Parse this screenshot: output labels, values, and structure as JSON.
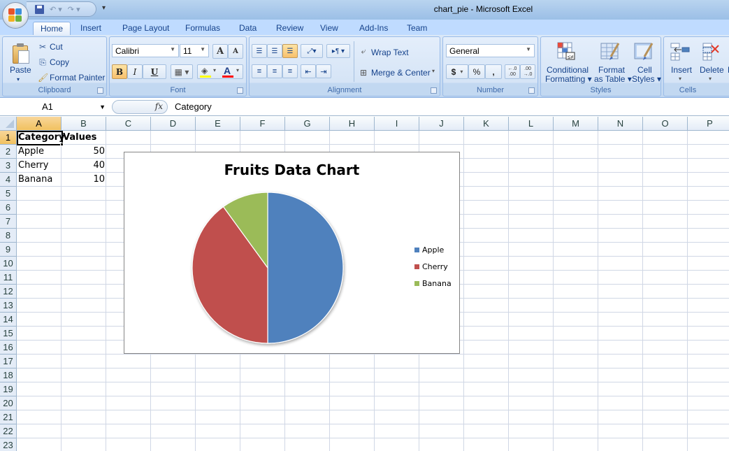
{
  "window": {
    "title": "chart_pie - Microsoft Excel"
  },
  "quick_access": {
    "items": [
      {
        "name": "save",
        "icon": "save-icon"
      },
      {
        "name": "undo",
        "icon": "undo-icon",
        "glyph": "↶ ▾"
      },
      {
        "name": "redo",
        "icon": "redo-icon",
        "glyph": "↷ ▾"
      }
    ],
    "customize_glyph": "▾"
  },
  "tabs": [
    {
      "label": "Home",
      "active": true
    },
    {
      "label": "Insert"
    },
    {
      "label": "Page Layout"
    },
    {
      "label": "Formulas"
    },
    {
      "label": "Data"
    },
    {
      "label": "Review"
    },
    {
      "label": "View"
    },
    {
      "label": "Add-Ins"
    },
    {
      "label": "Team"
    }
  ],
  "ribbon": {
    "clipboard": {
      "label": "Clipboard",
      "paste": "Paste",
      "cut": "Cut",
      "copy": "Copy",
      "format_painter": "Format Painter"
    },
    "font": {
      "label": "Font",
      "font_name": "Calibri",
      "font_size": "11",
      "grow": "A",
      "shrink": "A",
      "bold": "B",
      "italic": "I",
      "underline": "U",
      "highlight_color": "#ffff00",
      "font_color": "#ff0000"
    },
    "alignment": {
      "label": "Alignment",
      "wrap_text": "Wrap Text",
      "merge_center": "Merge & Center"
    },
    "number": {
      "label": "Number",
      "format": "General",
      "currency": "$",
      "percent": "%",
      "comma": ",",
      "inc_decimal": "←.0 .00",
      "dec_decimal": ".00 →.0"
    },
    "styles": {
      "label": "Styles",
      "conditional_formatting": [
        "Conditional",
        "Formatting ▾"
      ],
      "format_as_table": [
        "Format",
        "as Table ▾"
      ],
      "cell_styles": [
        "Cell",
        "Styles ▾"
      ]
    },
    "cells": {
      "label": "Cells",
      "insert": "Insert",
      "delete": "Delete",
      "format_partial": "F"
    }
  },
  "formula_bar": {
    "name_box": "A1",
    "fx": "fx",
    "value": "Category"
  },
  "sheet": {
    "columns": [
      "A",
      "B",
      "C",
      "D",
      "E",
      "F",
      "G",
      "H",
      "I",
      "J",
      "K",
      "L",
      "M",
      "N",
      "O",
      "P"
    ],
    "rows": [
      "1",
      "2",
      "3",
      "4",
      "5",
      "6",
      "7",
      "8",
      "9",
      "10",
      "11",
      "12",
      "13",
      "14",
      "15",
      "16",
      "17",
      "18",
      "19",
      "20",
      "21",
      "22",
      "23"
    ],
    "selected_cell": "A1",
    "cells": {
      "A1": "Category",
      "B1": "Values",
      "A2": "Apple",
      "B2": "50",
      "A3": "Cherry",
      "B3": "40",
      "A4": "Banana",
      "B4": "10"
    }
  },
  "chart_data": {
    "type": "pie",
    "title": "Fruits Data Chart",
    "categories": [
      "Apple",
      "Cherry",
      "Banana"
    ],
    "values": [
      50,
      40,
      10
    ],
    "colors": [
      "#4f81bd",
      "#c0504d",
      "#9bbb59"
    ],
    "start_angle_deg": 0,
    "direction": "clockwise",
    "legend_position": "right"
  }
}
